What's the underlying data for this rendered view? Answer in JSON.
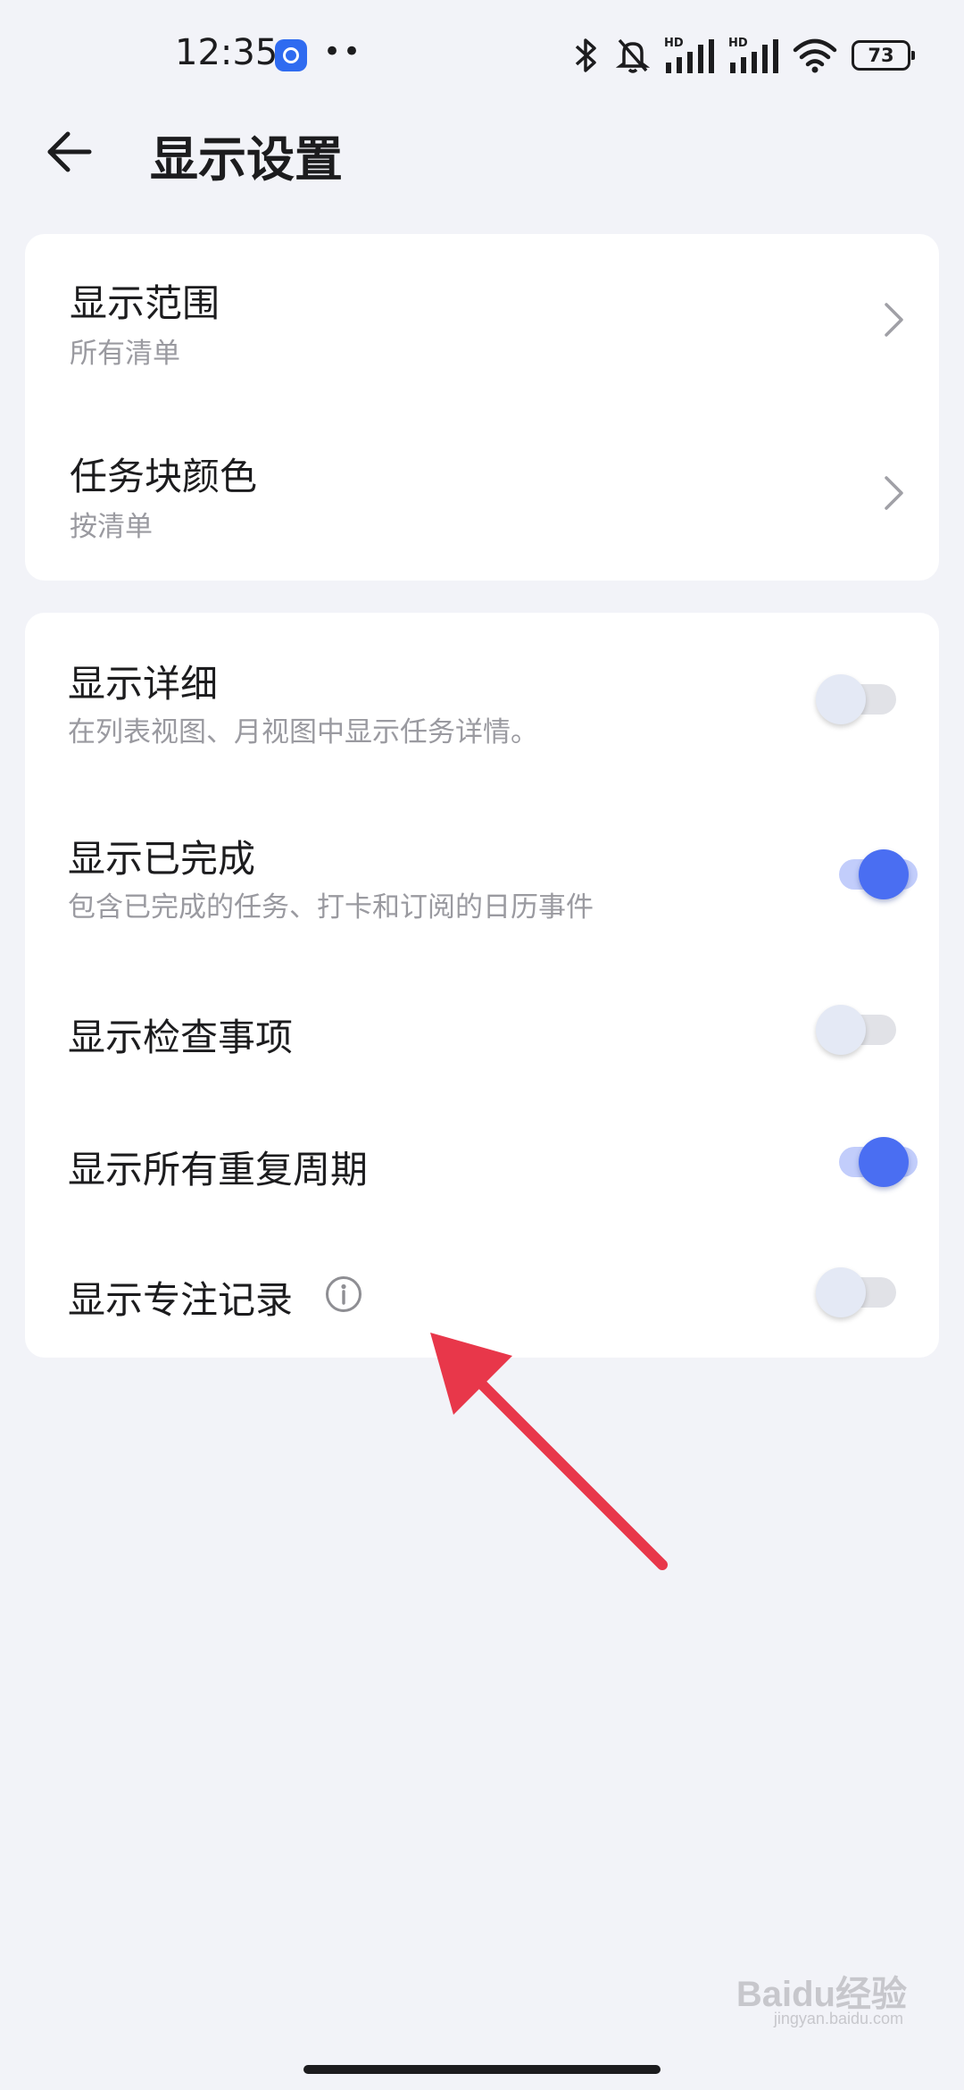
{
  "status_bar": {
    "time": "12:35",
    "dots": "••",
    "battery": "73",
    "network_label_1": "HD",
    "network_label_2": "HD",
    "icons": [
      "dingtalk-app-icon",
      "bluetooth-icon",
      "bell-muted-icon",
      "signal-icon",
      "signal-icon",
      "wifi-icon",
      "battery-icon"
    ]
  },
  "header": {
    "title": "显示设置",
    "back_icon": "arrow-left-icon"
  },
  "group1": [
    {
      "title": "显示范围",
      "subtitle": "所有清单"
    },
    {
      "title": "任务块颜色",
      "subtitle": "按清单"
    }
  ],
  "group2": [
    {
      "title": "显示详细",
      "subtitle": "在列表视图、月视图中显示任务详情。",
      "enabled": false
    },
    {
      "title": "显示已完成",
      "subtitle": "包含已完成的任务、打卡和订阅的日历事件",
      "enabled": true
    },
    {
      "title": "显示检查事项",
      "enabled": false
    },
    {
      "title": "显示所有重复周期",
      "enabled": true
    },
    {
      "title": "显示专注记录",
      "enabled": false,
      "info_icon": "info-icon"
    }
  ],
  "colors": {
    "accent": "#4a6ef2",
    "background": "#f2f3f8",
    "annotation": "#e8374a"
  },
  "watermark": {
    "text": "Baidu经验",
    "sub": "jingyan.baidu.com"
  }
}
